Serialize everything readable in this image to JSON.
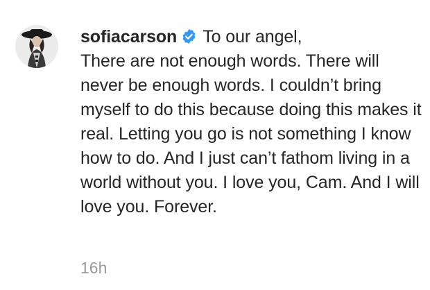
{
  "comment": {
    "username": "sofiacarson",
    "verified_icon": "verified-badge-icon",
    "text_first_line": "To our angel,",
    "text_body": "There are not enough words. There will never be enough words. I couldn’t bring myself to do this because doing this makes it real. Letting you go is not something I know how to do. And I just can’t fathom living in a world without you. I love you, Cam. And I will love you. Forever.",
    "timestamp": "16h"
  },
  "colors": {
    "text": "#262626",
    "verified_badge": "#3897f0",
    "timestamp": "#999999",
    "background": "#ffffff"
  }
}
